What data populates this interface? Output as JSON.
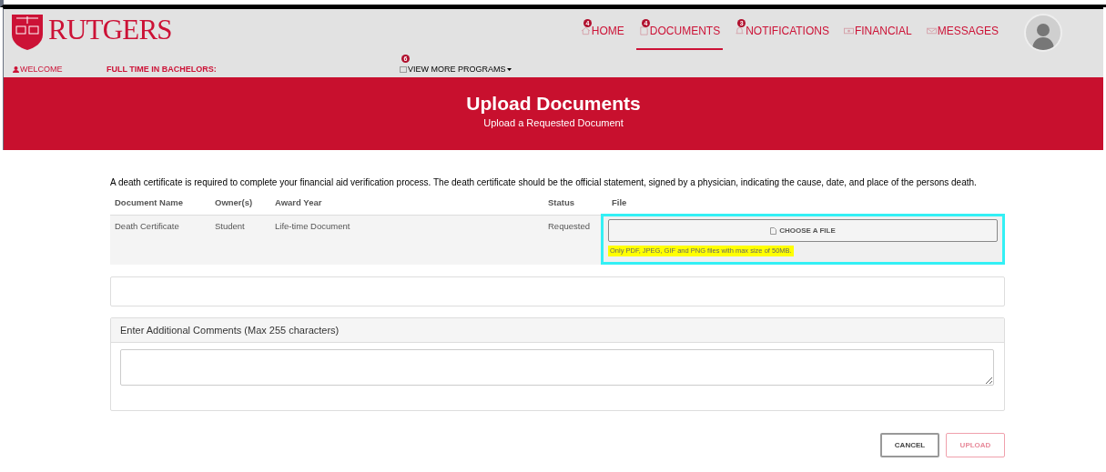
{
  "brand": {
    "name": "RUTGERS"
  },
  "nav": [
    {
      "label": "HOME",
      "badge": "4",
      "kind": "home",
      "selected": false
    },
    {
      "label": "DOCUMENTS",
      "badge": "4",
      "kind": "doc",
      "selected": true
    },
    {
      "label": "NOTIFICATIONS",
      "badge": "3",
      "kind": "bell",
      "selected": false
    },
    {
      "label": "FINANCIAL",
      "kind": "money",
      "selected": false
    },
    {
      "label": "MESSAGES",
      "kind": "mail",
      "selected": false
    }
  ],
  "subnav": {
    "welcome": "WELCOME",
    "program": "FULL TIME IN BACHELORS:",
    "more_programs": "VIEW MORE PROGRAMS",
    "more_badge": "6"
  },
  "banner": {
    "title": "Upload Documents",
    "subtitle": "Upload a Requested Document"
  },
  "description": "A death certificate is required to complete your financial aid verification process. The death certificate should be the official statement, signed by a physician, indicating the cause, date, and place of the persons death.",
  "table": {
    "columns": [
      "Document Name",
      "Owner(s)",
      "Award Year",
      "Status",
      "File"
    ],
    "rows": [
      {
        "cells": [
          "Death Certificate",
          "Student",
          "Life-time Document",
          "Requested"
        ],
        "file_button": "CHOOSE A FILE",
        "file_hint": "Only PDF, JPEG, GIF and PNG files with max size of 50MB."
      }
    ]
  },
  "comments": {
    "label": "Enter Additional Comments (Max 255 characters)"
  },
  "buttons": [
    {
      "label": "CANCEL",
      "disabled": false
    },
    {
      "label": "UPLOAD",
      "disabled": true
    }
  ]
}
